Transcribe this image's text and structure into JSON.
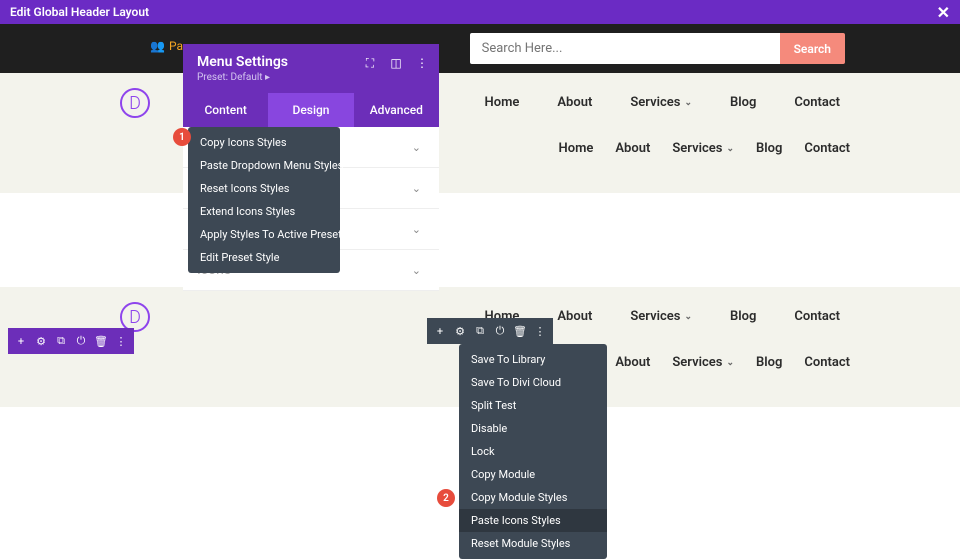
{
  "topbar": {
    "title": "Edit Global Header Layout"
  },
  "search": {
    "placeholder": "Search Here...",
    "button": "Search"
  },
  "people": {
    "label": "Pa"
  },
  "panel": {
    "title": "Menu Settings",
    "preset": "Preset: Default ▸",
    "tabs": {
      "content": "Content",
      "design": "Design",
      "advanced": "Advanced"
    },
    "icons_label": "Icons"
  },
  "ctx1": {
    "items": [
      "Copy Icons Styles",
      "Paste Dropdown Menu Styles",
      "Reset Icons Styles",
      "Extend Icons Styles",
      "Apply Styles To Active Preset",
      "Edit Preset Style"
    ]
  },
  "ctx2": {
    "items": [
      "Save To Library",
      "Save To Divi Cloud",
      "Split Test",
      "Disable",
      "Lock",
      "Copy Module",
      "Copy Module Styles",
      "Paste Icons Styles",
      "Reset Module Styles"
    ]
  },
  "nav": {
    "home": "Home",
    "about": "About",
    "services": "Services",
    "blog": "Blog",
    "contact": "Contact"
  },
  "badges": {
    "one": "1",
    "two": "2"
  }
}
